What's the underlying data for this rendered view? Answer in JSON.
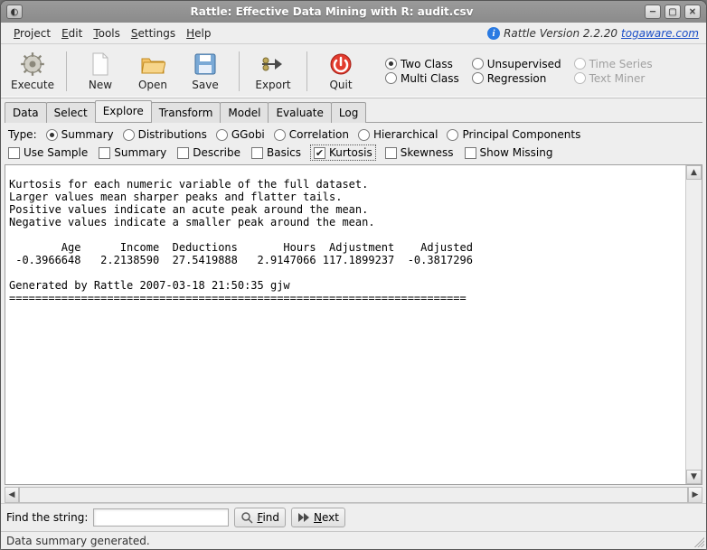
{
  "window": {
    "title": "Rattle: Effective Data Mining with R: audit.csv"
  },
  "menubar": {
    "project": "Project",
    "edit": "Edit",
    "tools": "Tools",
    "settings": "Settings",
    "help": "Help",
    "version_prefix": "Rattle Version 2.2.20",
    "version_link": "togaware.com"
  },
  "toolbar": {
    "execute": "Execute",
    "new": "New",
    "open": "Open",
    "save": "Save",
    "export_": "Export",
    "quit": "Quit"
  },
  "class_radios": {
    "two_class": "Two Class",
    "unsupervised": "Unsupervised",
    "time_series": "Time Series",
    "multi_class": "Multi Class",
    "regression": "Regression",
    "text_miner": "Text Miner",
    "selected": "two_class",
    "disabled": [
      "time_series",
      "text_miner"
    ]
  },
  "tabs": {
    "items": [
      "Data",
      "Select",
      "Explore",
      "Transform",
      "Model",
      "Evaluate",
      "Log"
    ],
    "active": "Explore"
  },
  "type_radios": {
    "label": "Type:",
    "items": [
      "Summary",
      "Distributions",
      "GGobi",
      "Correlation",
      "Hierarchical",
      "Principal Components"
    ],
    "selected": "Summary"
  },
  "checks": {
    "use_sample": {
      "label": "Use Sample",
      "checked": false
    },
    "summary": {
      "label": "Summary",
      "checked": false
    },
    "describe": {
      "label": "Describe",
      "checked": false
    },
    "basics": {
      "label": "Basics",
      "checked": false
    },
    "kurtosis": {
      "label": "Kurtosis",
      "checked": true,
      "focused": true
    },
    "skewness": {
      "label": "Skewness",
      "checked": false
    },
    "show_missing": {
      "label": "Show Missing",
      "checked": false
    }
  },
  "output_text": "Kurtosis for each numeric variable of the full dataset.\nLarger values mean sharper peaks and flatter tails.\nPositive values indicate an acute peak around the mean.\nNegative values indicate a smaller peak around the mean.\n\n        Age      Income  Deductions       Hours  Adjustment    Adjusted\n -0.3966648   2.2138590  27.5419888   2.9147066 117.1899237  -0.3817296\n\nGenerated by Rattle 2007-03-18 21:50:35 gjw\n======================================================================",
  "findbar": {
    "label": "Find the string:",
    "value": "",
    "find_label": "Find",
    "next_label": "Next"
  },
  "status": "Data summary generated."
}
